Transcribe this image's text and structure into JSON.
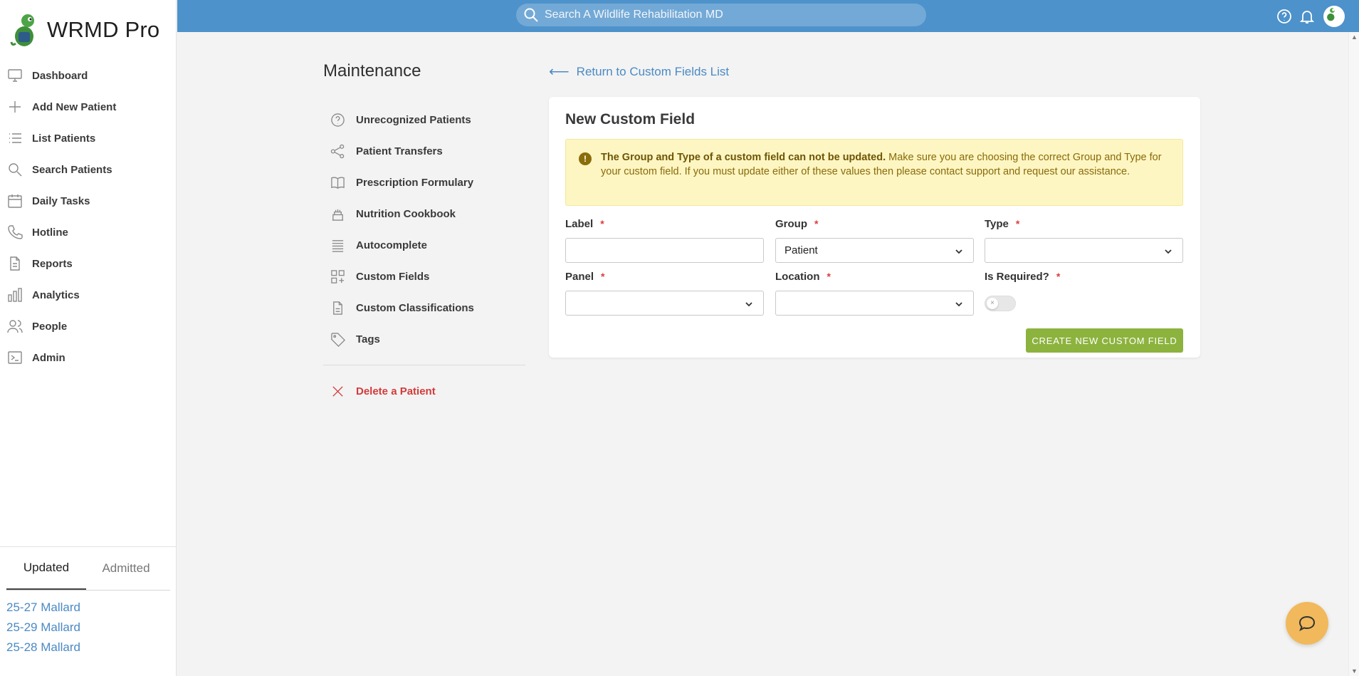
{
  "brand": {
    "name": "WRMD Pro"
  },
  "sidebar": {
    "items": [
      {
        "label": "Dashboard",
        "icon": "monitor-icon"
      },
      {
        "label": "Add New Patient",
        "icon": "plus-icon"
      },
      {
        "label": "List Patients",
        "icon": "list-icon"
      },
      {
        "label": "Search Patients",
        "icon": "search-icon"
      },
      {
        "label": "Daily Tasks",
        "icon": "calendar-icon"
      },
      {
        "label": "Hotline",
        "icon": "phone-icon"
      },
      {
        "label": "Reports",
        "icon": "document-icon"
      },
      {
        "label": "Analytics",
        "icon": "bar-chart-icon"
      },
      {
        "label": "People",
        "icon": "users-icon"
      },
      {
        "label": "Admin",
        "icon": "terminal-icon"
      }
    ]
  },
  "recent": {
    "tabs": [
      {
        "label": "Updated",
        "active": true
      },
      {
        "label": "Admitted",
        "active": false
      }
    ],
    "patients": [
      "25-27 Mallard",
      "25-29 Mallard",
      "25-28 Mallard"
    ]
  },
  "topbar": {
    "search_placeholder": "Search A Wildlife Rehabilitation MD",
    "icons": [
      "help-circle-icon",
      "bell-icon",
      "avatar"
    ]
  },
  "maintenance": {
    "title": "Maintenance",
    "items": [
      {
        "label": "Unrecognized Patients",
        "icon": "question-circle-icon"
      },
      {
        "label": "Patient Transfers",
        "icon": "share-icon"
      },
      {
        "label": "Prescription Formulary",
        "icon": "book-icon"
      },
      {
        "label": "Nutrition Cookbook",
        "icon": "cake-icon"
      },
      {
        "label": "Autocomplete",
        "icon": "lines-icon"
      },
      {
        "label": "Custom Fields",
        "icon": "grid-plus-icon"
      },
      {
        "label": "Custom Classifications",
        "icon": "file-icon"
      },
      {
        "label": "Tags",
        "icon": "tag-icon"
      }
    ],
    "delete_label": "Delete a Patient"
  },
  "back_link": "Return to Custom Fields List",
  "form": {
    "title": "New Custom Field",
    "alert_bold": "The Group and Type of a custom field can not be updated.",
    "alert_rest": "Make sure you are choosing the correct Group and Type for your custom field. If you must update either of these values then please contact support and request our assistance.",
    "fields": {
      "label": {
        "label": "Label",
        "value": ""
      },
      "group": {
        "label": "Group",
        "value": "Patient"
      },
      "type": {
        "label": "Type",
        "value": ""
      },
      "panel": {
        "label": "Panel",
        "value": ""
      },
      "location": {
        "label": "Location",
        "value": ""
      },
      "required": {
        "label": "Is Required?",
        "value": false
      }
    },
    "required_marker": "*",
    "submit_label": "CREATE NEW CUSTOM FIELD"
  },
  "colors": {
    "topbar": "#4d92cb",
    "link": "#4a8ac4",
    "button": "#8cb33e",
    "alert_bg": "#fdf6c2",
    "danger": "#d23b3b",
    "chat": "#f1b95c"
  }
}
